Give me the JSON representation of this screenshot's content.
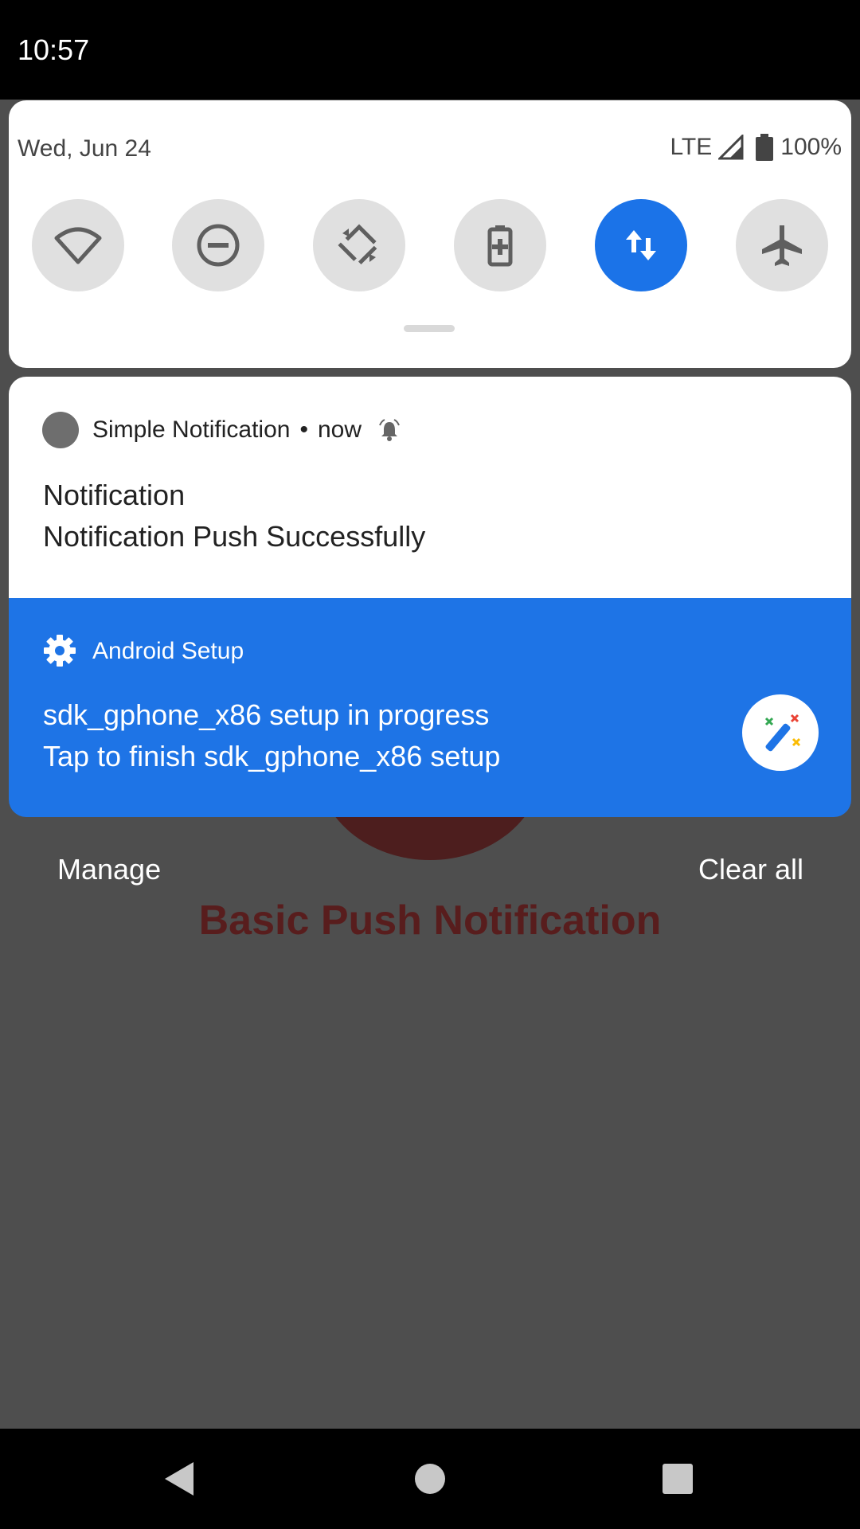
{
  "status_bar": {
    "time": "10:57"
  },
  "quick_settings": {
    "date": "Wed, Jun 24",
    "network": "LTE",
    "battery": "100%",
    "tiles": [
      "wifi",
      "do-not-disturb",
      "auto-rotate",
      "battery-saver",
      "mobile-data",
      "airplane-mode"
    ],
    "active_tile": "mobile-data"
  },
  "notifications": [
    {
      "app": "Simple Notification",
      "separator": "•",
      "time": "now",
      "title": "Notification",
      "text": "Notification Push Successfully"
    },
    {
      "app": "Android Setup",
      "title": "sdk_gphone_x86 setup in progress",
      "text": "Tap to finish sdk_gphone_x86 setup"
    }
  ],
  "actions": {
    "manage": "Manage",
    "clear_all": "Clear all"
  },
  "app": {
    "title": "Basic Push Notification"
  },
  "colors": {
    "accent": "#1b73e8",
    "notification_blue": "#1e74e6",
    "app_title": "#581d1d"
  }
}
